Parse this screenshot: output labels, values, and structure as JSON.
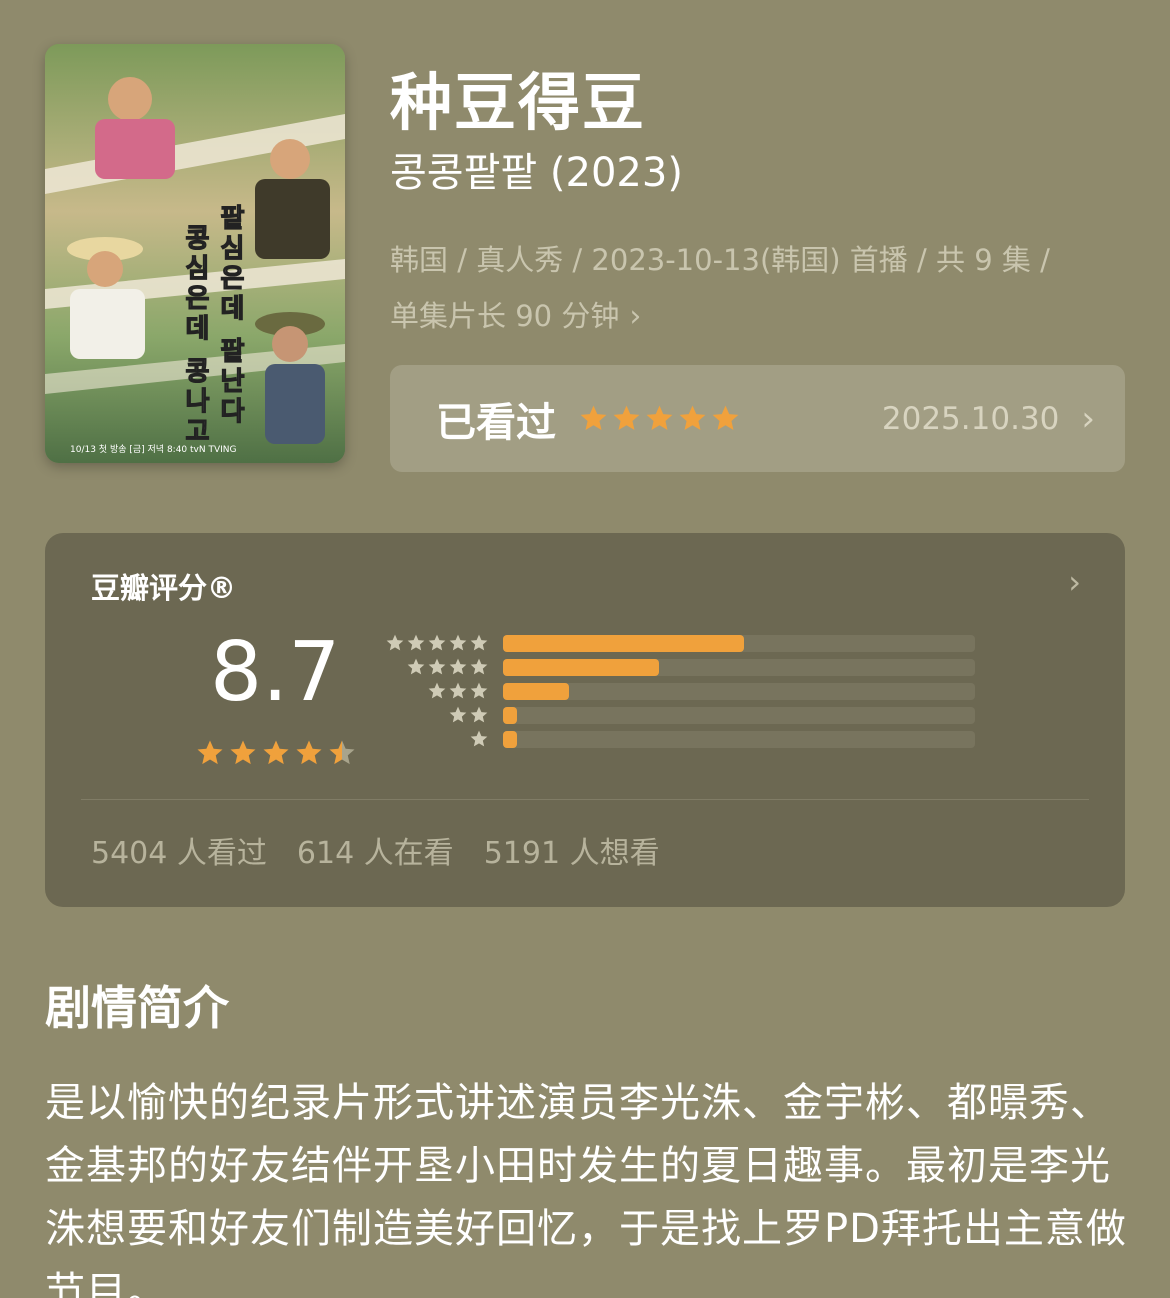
{
  "show": {
    "title": "种豆得豆",
    "subtitle": "콩콩팥팥 (2023)",
    "meta_line1": "韩国 / 真人秀 / 2023-10-13(韩国) 首播 / 共 9 集 /",
    "meta_line2": "单集片长 90 分钟",
    "poster_text": {
      "vertical_left": "콩심은데 콩나고",
      "vertical_right": "팥심은데 팥난다",
      "bottom": "10/13 첫 방송 [금] 저녁 8:40 tvN TVING"
    }
  },
  "watched": {
    "label": "已看过",
    "stars": 5,
    "date": "2025.10.30"
  },
  "rating": {
    "title": "豆瓣评分®",
    "score": "8.7",
    "score_stars": 4.5,
    "distribution": [
      {
        "stars": 5,
        "fraction": 0.51
      },
      {
        "stars": 4,
        "fraction": 0.33
      },
      {
        "stars": 3,
        "fraction": 0.14
      },
      {
        "stars": 2,
        "fraction": 0.03
      },
      {
        "stars": 1,
        "fraction": 0.03
      }
    ],
    "counts": {
      "watched": "5404 人看过",
      "watching": "614 人在看",
      "want": "5191 人想看"
    }
  },
  "synopsis": {
    "heading": "剧情简介",
    "text": "是以愉快的纪录片形式讲述演员李光洙、金宇彬、都暻秀、金基邦的好友结伴开垦小田时发生的夏日趣事。最初是李光洙想要和好友们制造美好回忆，于是找上罗PD拜托出主意做节目。"
  },
  "colors": {
    "background": "#8f8a6c",
    "card": "#6c6852",
    "star": "#f0a13c",
    "star_empty": "#a8a48c"
  },
  "icons": {
    "chevron": "chevron-right-icon",
    "star": "star-icon"
  }
}
